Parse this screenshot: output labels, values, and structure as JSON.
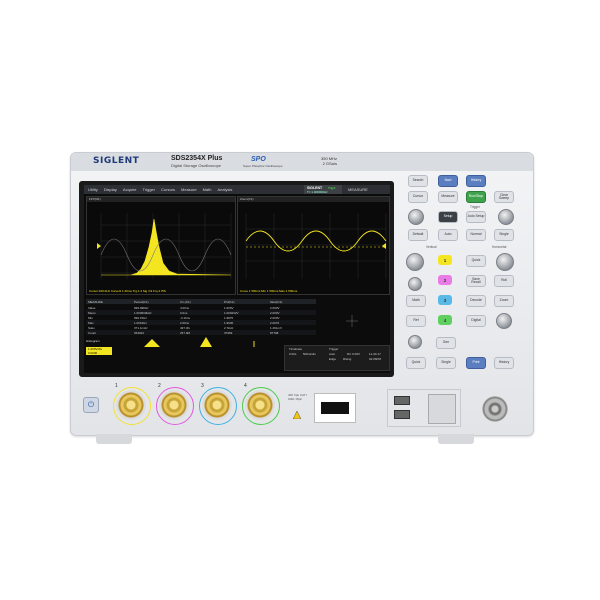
{
  "device": {
    "brand": "SIGLENT",
    "model": "SDS2354X Plus",
    "subtitle": "Digital Storage Oscilloscope",
    "tech_logo": "SPO",
    "tech_sub": "Super Phosphor Oscilloscope",
    "bandwidth": "350 MHz",
    "sample_rate": "2 GSa/s"
  },
  "screen": {
    "menu": [
      "Utility",
      "Display",
      "Acquire",
      "Trigger",
      "Cursors",
      "Measure",
      "Math",
      "Analysis"
    ],
    "badge": {
      "line1": "SIGLENT",
      "line2": "T= 1.000000Hz",
      "line3": "Trig'd"
    },
    "measure_label": "MEASURE",
    "window1_title": "FFT(M1)",
    "window2_title": "Zoom(C1)",
    "window1_caption": "Cursor:100.0Hz  Curvel1 1.40ms   Trg:1.4 Sig 4.9 Frq 4.7Pk",
    "window2_caption": "Curve 1 500ms   Min 1 500ms   Max 1 500ms",
    "meas_headers": [
      "MEASURE",
      "Period(C1)",
      "C1-(C1)",
      "Prd(C1)",
      "Slew(C1)"
    ],
    "meas_rows": [
      [
        "Value",
        "999.998Hz",
        "4.00ns",
        "1.000V",
        "2.000V"
      ],
      [
        "Mean",
        "1.000000kHz",
        "0.0ns",
        "1.000232V",
        "2.000V"
      ],
      [
        "Min",
        "999.15Hz",
        "-3.16ns",
        "1.9870",
        "2.000V"
      ],
      [
        "Max",
        "1.0016Hz",
        "2.00ns",
        "1.9930",
        "2.0070"
      ],
      [
        "Sdev",
        "371.1mHz",
        "497.3fs",
        "2.7kHz",
        "1.461mV"
      ],
      [
        "Count",
        "364922",
        "257.9M",
        "37969",
        "87798"
      ]
    ],
    "histogram_label": "Histogram",
    "status": {
      "timebase_label": "Timebase",
      "timebase": "0.00s",
      "timebase2": "500ns/div",
      "trigger_label": "Trigger",
      "trigger": "Auto",
      "edge": "Edge",
      "rising": "Rising",
      "level": "DC  0.00V",
      "date": "11-30-17",
      "time": "02:06PM"
    },
    "ch_label1": "1.000V/div",
    "ch_label2": "0.0000"
  },
  "controls": {
    "row1": [
      "Search",
      "Navi",
      "History"
    ],
    "row2": [
      "Cursor",
      "Measure"
    ],
    "row3": [
      "Run/Stop",
      "Single"
    ],
    "auto_setup": "Auto Setup",
    "default": "Default",
    "clear_sweep": "Clear Sweep",
    "print": "Print",
    "trigger_group": "Trigger",
    "setup": "Setup",
    "auto": "Auto",
    "normal": "Normal",
    "single": "Single",
    "vertical": "Vertical",
    "horizontal": "Horizontal",
    "roll": "Roll",
    "zoom": "Zoom",
    "ch": [
      "1",
      "2",
      "3",
      "4"
    ],
    "math": "Math",
    "ref": "Ref",
    "digital": "Digital",
    "decode": "Decode",
    "gen": "Gen",
    "history": "History",
    "quick": "Quick",
    "save_recall": "Save Recall"
  },
  "front": {
    "channels": [
      "1",
      "2",
      "3",
      "4"
    ],
    "warning": "400 Vpk CAT I  1MΩ 15pF",
    "ext_label": "EXT TRIG"
  },
  "colors": {
    "ch1": "#f2e232",
    "ch2": "#e25adf",
    "ch3": "#3fb1e0",
    "ch4": "#4ccb4c"
  }
}
